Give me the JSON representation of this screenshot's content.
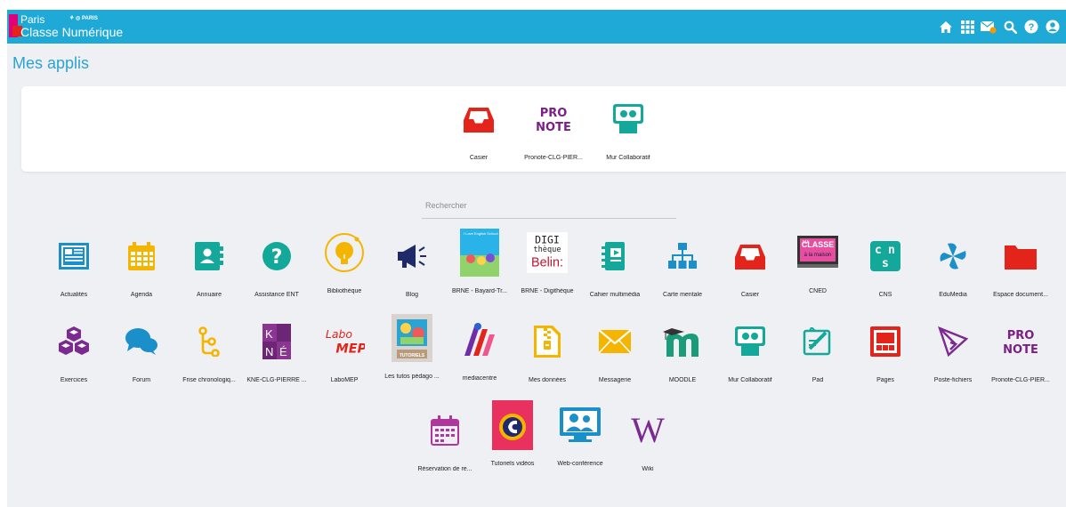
{
  "header": {
    "logo_line1": "Paris",
    "logo_line2": "Classe Numérique",
    "logo_partner": "⚘ ◎ PARIS",
    "icons": [
      "home-icon",
      "apps-grid-icon",
      "mail-icon",
      "search-icon",
      "help-icon",
      "user-icon"
    ]
  },
  "page_title": "Mes applis",
  "favorites": [
    {
      "label": "Casier",
      "icon": "casier-icon"
    },
    {
      "label": "Pronote-CLG-PIER...",
      "icon": "pronote-icon",
      "icon_text": "PRO NOTE"
    },
    {
      "label": "Mur Collaboratif",
      "icon": "mur-collaboratif-icon"
    }
  ],
  "search": {
    "placeholder": "Rechercher",
    "value": ""
  },
  "apps": [
    {
      "label": "Actualités",
      "icon": "newspaper-icon"
    },
    {
      "label": "Agenda",
      "icon": "calendar-icon"
    },
    {
      "label": "Annuaire",
      "icon": "contact-book-icon"
    },
    {
      "label": "Assistance ENT",
      "icon": "question-icon"
    },
    {
      "label": "Bibliothèque",
      "icon": "lightbulb-icon"
    },
    {
      "label": "Blog",
      "icon": "megaphone-icon"
    },
    {
      "label": "BRNE - Bayard-Tr...",
      "icon": "bayard-book-icon",
      "icon_text": "I Love English School"
    },
    {
      "label": "BRNE - Digithèque",
      "icon": "digitheque-icon",
      "icon_text": "DIGI thèque Belin:"
    },
    {
      "label": "Cahier multimédia",
      "icon": "notebook-icon"
    },
    {
      "label": "Carte mentale",
      "icon": "mind-map-icon"
    },
    {
      "label": "Casier",
      "icon": "casier-icon"
    },
    {
      "label": "CNED",
      "icon": "cned-icon",
      "icon_text": "MA CLASSE à la maison"
    },
    {
      "label": "CNS",
      "icon": "cns-icon",
      "icon_text": "c n s"
    },
    {
      "label": "EduMedia",
      "icon": "edumedia-icon"
    },
    {
      "label": "Espace document...",
      "icon": "folder-icon"
    },
    {
      "label": "Exercices",
      "icon": "cubes-icon"
    },
    {
      "label": "Forum",
      "icon": "chat-bubbles-icon"
    },
    {
      "label": "Frise chronologiq...",
      "icon": "timeline-icon"
    },
    {
      "label": "KNE-CLG-PIERRE ...",
      "icon": "kne-icon",
      "icon_text": "K N É"
    },
    {
      "label": "LaboMEP",
      "icon": "labomep-icon",
      "icon_text": "Labo MEP"
    },
    {
      "label": "Les tutos pédago ...",
      "icon": "tutoriels-icon",
      "icon_text": "TUTORIELS"
    },
    {
      "label": "mediacentre",
      "icon": "mediacentre-icon"
    },
    {
      "label": "Mes données",
      "icon": "zip-file-icon"
    },
    {
      "label": "Messagerie",
      "icon": "envelope-icon"
    },
    {
      "label": "MOODLE",
      "icon": "moodle-icon"
    },
    {
      "label": "Mur Collaboratif",
      "icon": "mur-collaboratif-icon"
    },
    {
      "label": "Pad",
      "icon": "pad-icon"
    },
    {
      "label": "Pages",
      "icon": "pages-icon"
    },
    {
      "label": "Poste-fichiers",
      "icon": "paper-plane-icon"
    },
    {
      "label": "Pronote-CLG-PIER...",
      "icon": "pronote-icon",
      "icon_text": "PRO NOTE"
    },
    {
      "label": "Réservation de re...",
      "icon": "reservation-icon"
    },
    {
      "label": "Tutoriels vidéos",
      "icon": "video-tutorials-icon"
    },
    {
      "label": "Web-conférence",
      "icon": "web-conference-icon"
    },
    {
      "label": "Wiki",
      "icon": "wiki-icon",
      "icon_text": "W"
    }
  ],
  "colors": {
    "topbar": "#1fa9d6",
    "title": "#2aa4d2",
    "background": "#eef0f3",
    "icon_blue": "#1a8fc9",
    "icon_yellow": "#f5b400",
    "icon_teal": "#14a89a",
    "icon_red": "#e2241b",
    "icon_purple": "#8a2a9e",
    "icon_magenta": "#d6008a"
  }
}
